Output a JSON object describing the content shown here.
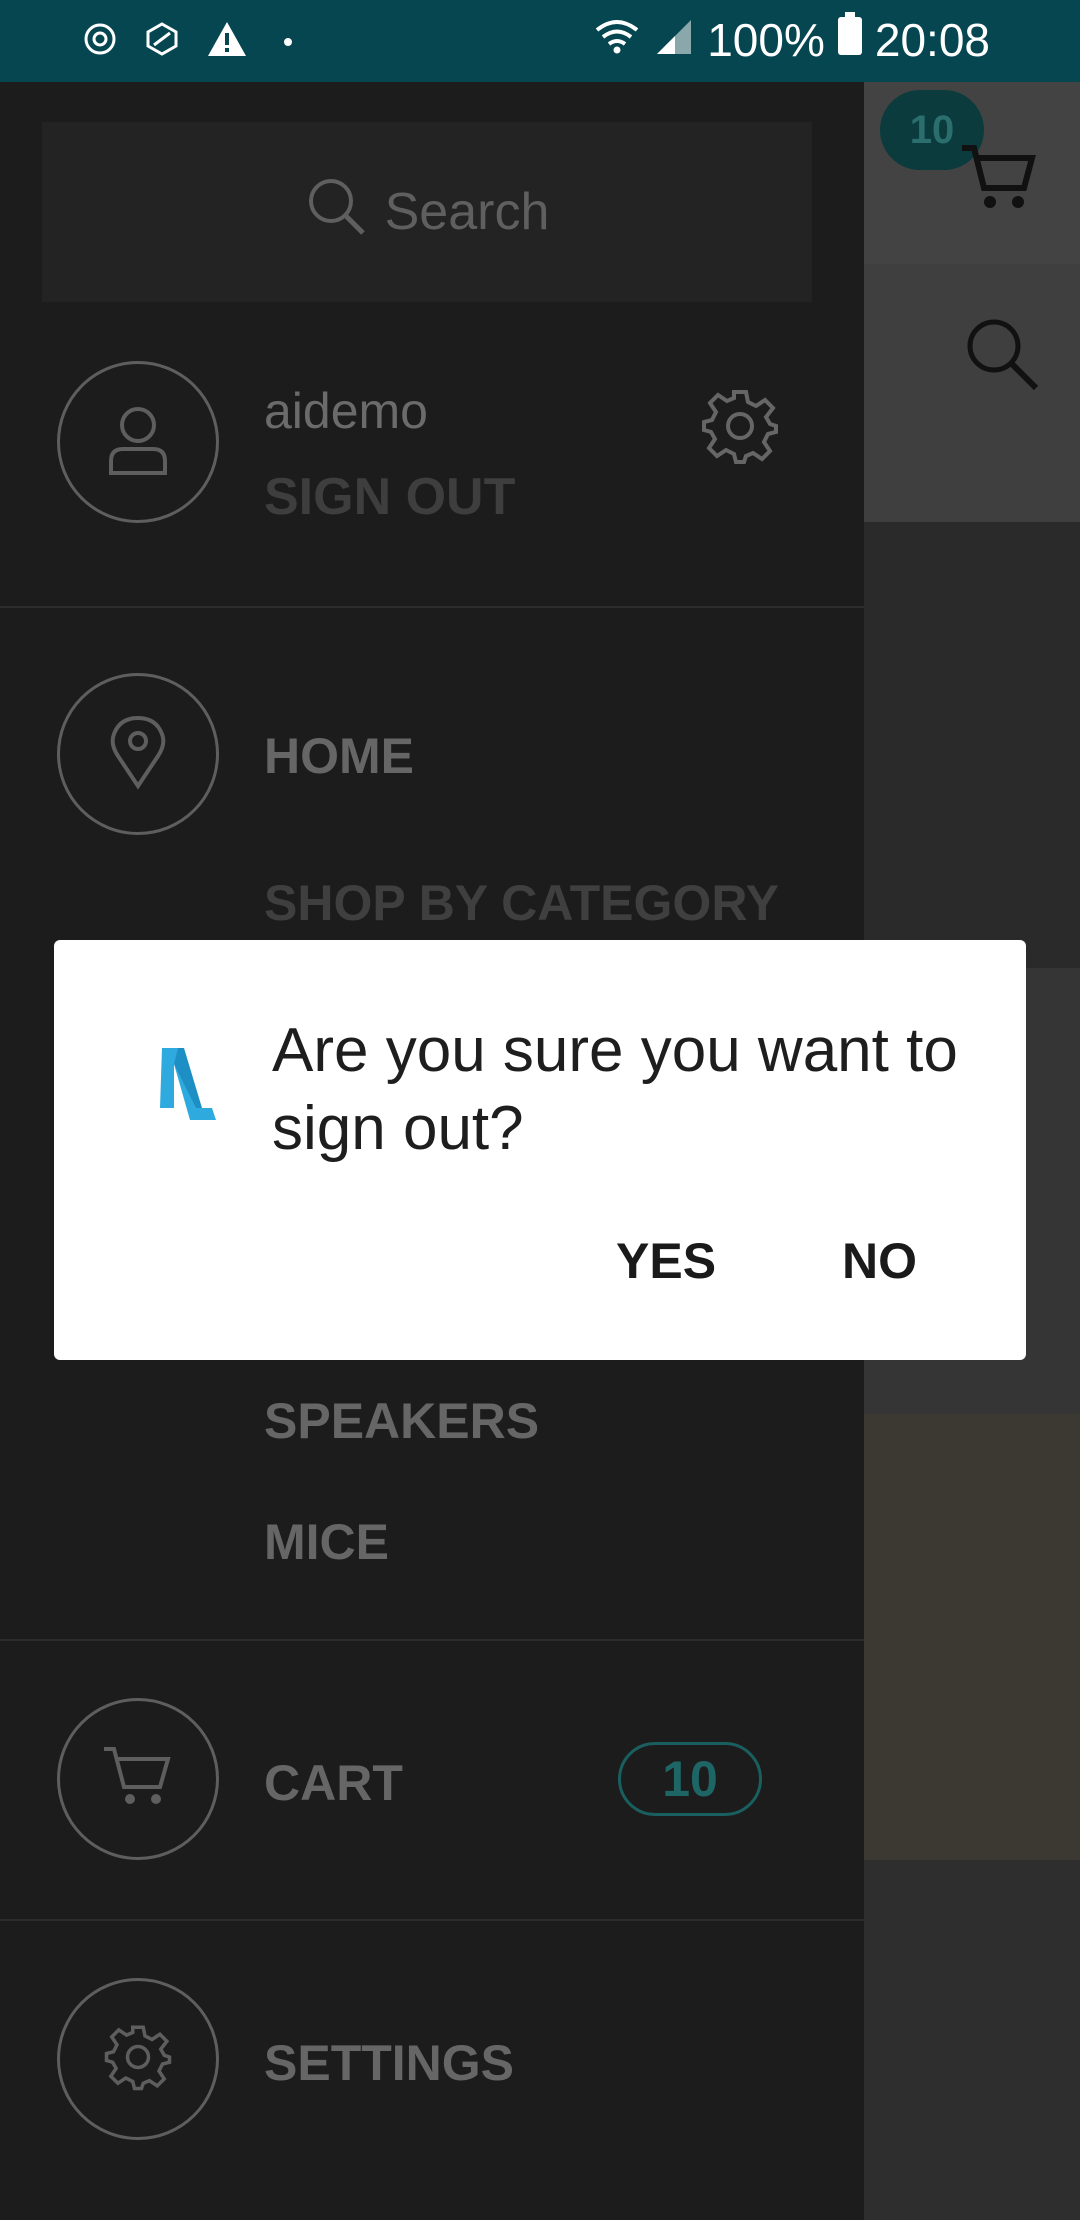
{
  "status_bar": {
    "battery": "100%",
    "time": "20:08",
    "left_icons": [
      "settings-notification-icon",
      "app-notification-icon",
      "warning-icon"
    ],
    "right_icons": [
      "wifi-icon",
      "signal-icon",
      "battery-icon"
    ]
  },
  "background_app": {
    "cart_count": "10",
    "icons": [
      "cart-icon",
      "search-icon"
    ]
  },
  "drawer": {
    "search": {
      "label": "Search",
      "icon": "search-icon"
    },
    "user": {
      "name": "aidemo",
      "sign_out": "SIGN OUT",
      "avatar_icon": "user-icon",
      "settings_icon": "gear-icon"
    },
    "menu": {
      "home": "HOME",
      "shop_by_category": "SHOP BY CATEGORY",
      "speakers": "SPEAKERS",
      "mice": "MICE",
      "cart": "CART",
      "cart_badge": "10",
      "settings": "SETTINGS"
    }
  },
  "dialog": {
    "message": "Are you sure you want to sign out?",
    "yes": "YES",
    "no": "NO",
    "logo_color": "#2FAADF"
  },
  "colors": {
    "status_bar": "#054651",
    "drawer_bg": "#1C1C1C",
    "badge_accent": "#1E6666"
  }
}
